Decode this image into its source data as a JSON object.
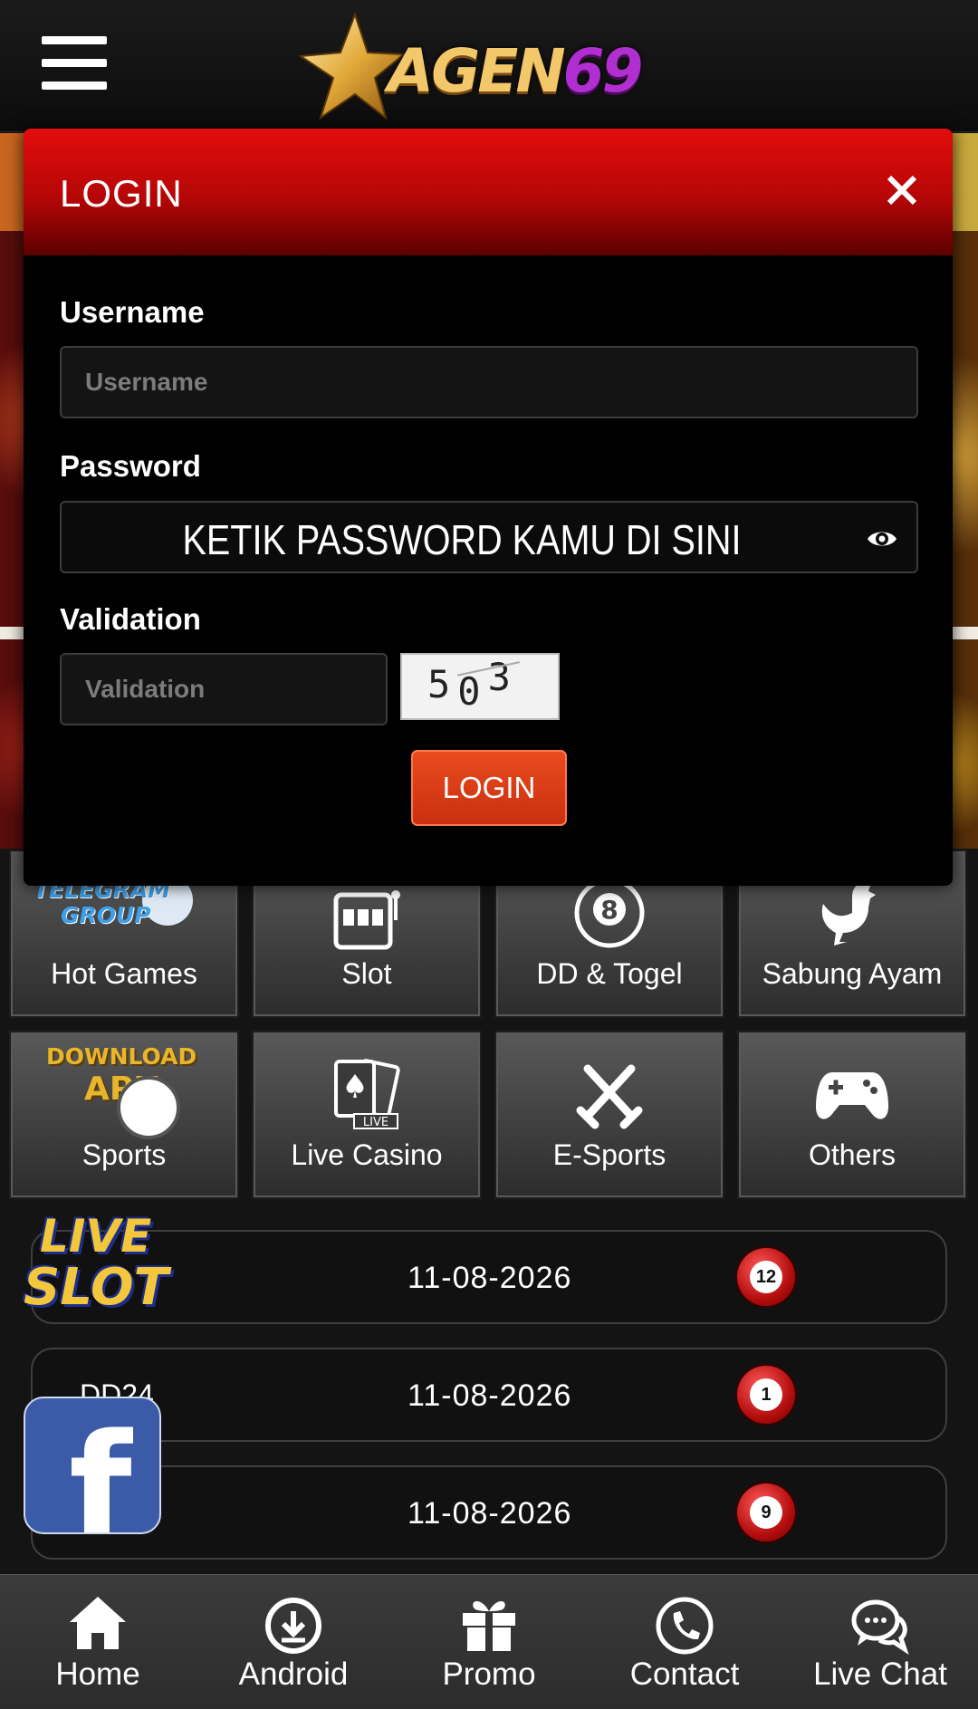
{
  "header": {
    "logo_text_part1": "AGEN",
    "logo_text_part2": "69",
    "menu_icon": "hamburger-menu-icon"
  },
  "login_modal": {
    "title": "LOGIN",
    "close_icon": "close-icon",
    "username_label": "Username",
    "username_placeholder": "Username",
    "password_label": "Password",
    "password_hint": "KETIK PASSWORD KAMU DI SINI",
    "password_icon": "eye-icon",
    "validation_label": "Validation",
    "validation_placeholder": "Validation",
    "captcha_digits": [
      "5",
      "0",
      "3"
    ],
    "login_button": "LOGIN"
  },
  "games": [
    {
      "label": "Hot Games",
      "icon": "telegram-group-icon",
      "overlay": [
        "TELEGRAM",
        "GROUP"
      ]
    },
    {
      "label": "Slot",
      "icon": "slot-machine-icon"
    },
    {
      "label": "DD & Togel",
      "icon": "eight-ball-icon",
      "icon_text": "8"
    },
    {
      "label": "Sabung Ayam",
      "icon": "rooster-icon"
    },
    {
      "label": "Sports",
      "icon": "download-apk-icon",
      "overlay": [
        "DOWNLOAD",
        "APK"
      ]
    },
    {
      "label": "Live Casino",
      "icon": "playing-cards-icon",
      "icon_text": "LIVE"
    },
    {
      "label": "E-Sports",
      "icon": "crossed-swords-icon"
    },
    {
      "label": "Others",
      "icon": "gamepad-icon"
    }
  ],
  "results": [
    {
      "market": "",
      "date": "11-08-2026",
      "ball": "12"
    },
    {
      "market": "DD24",
      "date": "11-08-2026",
      "ball": "1"
    },
    {
      "market": "",
      "date": "11-08-2026",
      "ball": "9"
    }
  ],
  "floating": {
    "live_slot_line1": "LIVE",
    "live_slot_line2": "SLOT",
    "facebook_letter": "f"
  },
  "bottom_nav": [
    {
      "label": "Home",
      "icon": "home-icon"
    },
    {
      "label": "Android",
      "icon": "download-icon"
    },
    {
      "label": "Promo",
      "icon": "gift-icon"
    },
    {
      "label": "Contact",
      "icon": "phone-icon"
    },
    {
      "label": "Live Chat",
      "icon": "chat-icon"
    }
  ],
  "colors": {
    "modal_header_red": "#e30d0d",
    "login_button": "#d8401a",
    "logo_gold": "#f2c86a",
    "logo_purple": "#b12fd0",
    "result_ball_red": "#b50e0e",
    "facebook_blue": "#3b5ba8"
  }
}
